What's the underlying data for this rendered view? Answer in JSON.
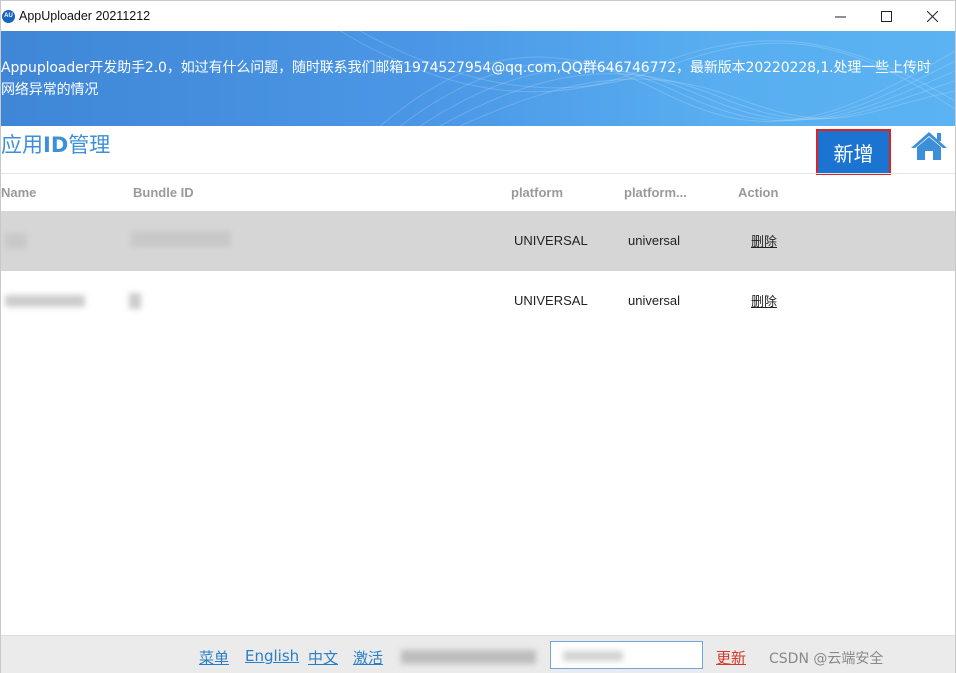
{
  "window": {
    "title": "AppUploader 20211212",
    "icon_text": "AU"
  },
  "banner": {
    "line1": "Appuploader开发助手2.0，如过有什么问题，随时联系我们邮箱1974527954@qq.com,QQ群646746772，最新版本20220228,1.处理一些上传时",
    "line2": "网络异常的情况"
  },
  "page": {
    "title_prefix": "应用",
    "title_bold": "ID",
    "title_suffix": "管理",
    "add_label": "新增",
    "home_icon": "home-icon"
  },
  "table": {
    "columns": [
      "Name",
      "Bundle ID",
      "platform",
      "platform...",
      "Action"
    ],
    "rows": [
      {
        "platform": "UNIVERSAL",
        "platform2": "universal",
        "action": "删除"
      },
      {
        "platform": "UNIVERSAL",
        "platform2": "universal",
        "action": "删除"
      }
    ]
  },
  "footer": {
    "menu": "菜单",
    "english": "English",
    "chinese": "中文",
    "activate": "激活",
    "update": "更新",
    "watermark": "CSDN @云端安全"
  },
  "colors": {
    "accent": "#3d8fd9",
    "button": "#1b74d2",
    "selected_row": "#d6d6d6",
    "link": "#2a7ec6",
    "update_link": "#d23a2a"
  }
}
